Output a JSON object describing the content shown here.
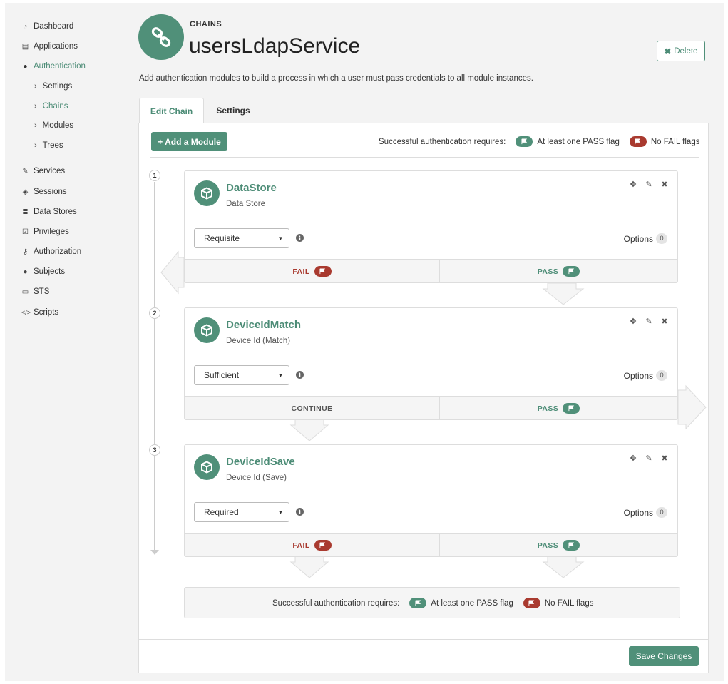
{
  "sidebar": {
    "items": [
      {
        "label": "Dashboard",
        "icon": "dashboard-icon"
      },
      {
        "label": "Applications",
        "icon": "applications-icon"
      },
      {
        "label": "Authentication",
        "icon": "user-icon"
      },
      {
        "label": "Services",
        "icon": "plug-icon"
      },
      {
        "label": "Sessions",
        "icon": "ticket-icon"
      },
      {
        "label": "Data Stores",
        "icon": "database-icon"
      },
      {
        "label": "Privileges",
        "icon": "check-square-icon"
      },
      {
        "label": "Authorization",
        "icon": "key-icon"
      },
      {
        "label": "Subjects",
        "icon": "users-icon"
      },
      {
        "label": "STS",
        "icon": "sts-icon"
      },
      {
        "label": "Scripts",
        "icon": "code-icon"
      }
    ],
    "auth_sub": [
      {
        "label": "Settings"
      },
      {
        "label": "Chains"
      },
      {
        "label": "Modules"
      },
      {
        "label": "Trees"
      }
    ]
  },
  "header": {
    "eyebrow": "CHAINS",
    "title": "usersLdapService",
    "delete_label": "Delete",
    "description": "Add authentication modules to build a process in which a user must pass credentials to all module instances."
  },
  "tabs": [
    {
      "label": "Edit Chain"
    },
    {
      "label": "Settings"
    }
  ],
  "toolbar": {
    "add_label": "+ Add a Module",
    "requires_label": "Successful authentication requires:",
    "pass_flag_label": "At least one PASS flag",
    "fail_flag_label": "No FAIL flags"
  },
  "modules": [
    {
      "step": "1",
      "title": "DataStore",
      "subtitle": "Data Store",
      "criteria": "Requisite",
      "options_label": "Options",
      "options_count": "0",
      "left_outcome": "FAIL",
      "right_outcome": "PASS"
    },
    {
      "step": "2",
      "title": "DeviceIdMatch",
      "subtitle": "Device Id (Match)",
      "criteria": "Sufficient",
      "options_label": "Options",
      "options_count": "0",
      "left_outcome": "CONTINUE",
      "right_outcome": "PASS"
    },
    {
      "step": "3",
      "title": "DeviceIdSave",
      "subtitle": "Device Id (Save)",
      "criteria": "Required",
      "options_label": "Options",
      "options_count": "0",
      "left_outcome": "FAIL",
      "right_outcome": "PASS"
    }
  ],
  "footer": {
    "requires_label": "Successful authentication requires:",
    "pass_flag_label": "At least one PASS flag",
    "fail_flag_label": "No FAIL flags",
    "save_label": "Save Changes"
  },
  "colors": {
    "accent": "#509079",
    "fail": "#a93a2f"
  }
}
